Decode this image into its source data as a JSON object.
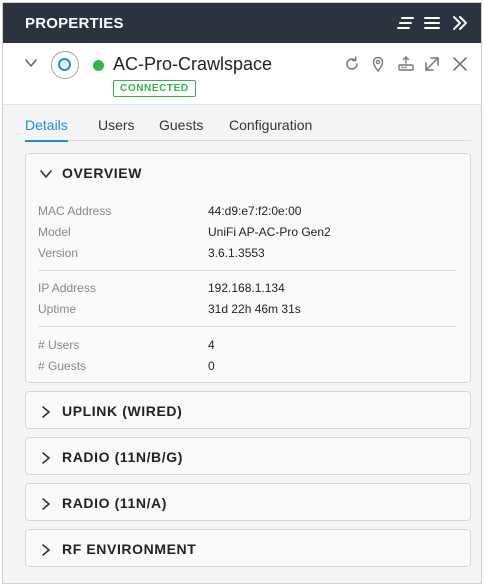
{
  "topbar": {
    "title": "PROPERTIES",
    "icons": [
      "filter-lines-icon",
      "hamburger-menu-icon",
      "double-chevron-right-icon"
    ]
  },
  "device": {
    "name": "AC-Pro-Crawlspace",
    "status": "CONNECTED",
    "status_color": "#35b24a",
    "icons": [
      "refresh-icon",
      "location-pin-icon",
      "upgrade-firmware-icon",
      "expand-icon",
      "close-icon"
    ]
  },
  "tabs": [
    {
      "label": "Details",
      "active": true
    },
    {
      "label": "Users",
      "active": false
    },
    {
      "label": "Guests",
      "active": false
    },
    {
      "label": "Configuration",
      "active": false
    }
  ],
  "overview": {
    "title": "OVERVIEW",
    "rows": [
      {
        "key": "MAC Address",
        "value": "44:d9:e7:f2:0e:00"
      },
      {
        "key": "Model",
        "value": "UniFi AP-AC-Pro Gen2"
      },
      {
        "key": "Version",
        "value": "3.6.1.3553"
      },
      {
        "key": "IP Address",
        "value": "192.168.1.134"
      },
      {
        "key": "Uptime",
        "value": "31d 22h 46m 31s"
      },
      {
        "key": "# Users",
        "value": "4"
      },
      {
        "key": "# Guests",
        "value": "0"
      }
    ]
  },
  "sections": [
    {
      "title": "UPLINK (WIRED)"
    },
    {
      "title": "RADIO (11N/B/G)"
    },
    {
      "title": "RADIO (11N/A)"
    },
    {
      "title": "RF ENVIRONMENT"
    }
  ],
  "colors": {
    "header_bg": "#2b3340",
    "accent": "#1b8ee0",
    "connected": "#35b24a"
  }
}
